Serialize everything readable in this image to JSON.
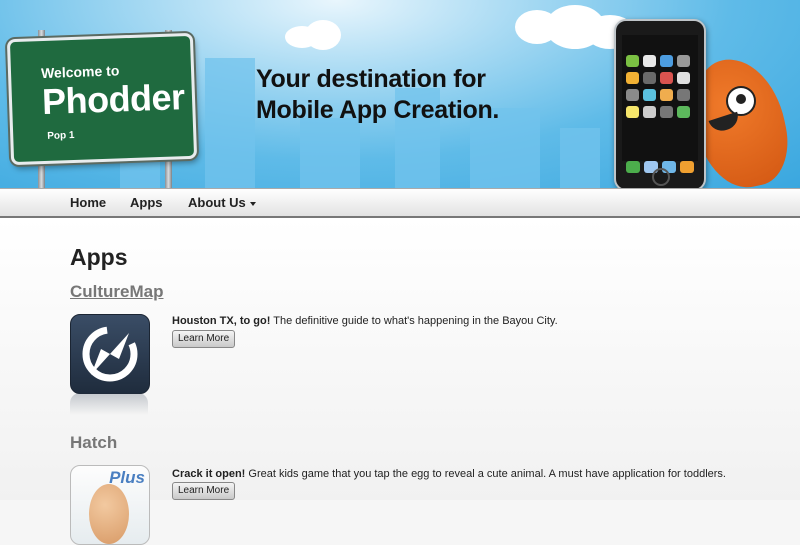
{
  "banner": {
    "sign": {
      "line1": "Welcome to",
      "line2": "Phodder",
      "pop": "Pop 1"
    },
    "tagline": {
      "line1": "Your destination for",
      "line2": "Mobile App Creation."
    }
  },
  "nav": {
    "items": [
      {
        "label": "Home"
      },
      {
        "label": "Apps"
      },
      {
        "label": "About Us",
        "icon": "caret-down-icon"
      }
    ]
  },
  "page": {
    "heading": "Apps",
    "apps": [
      {
        "title": "CultureMap",
        "desc_bold": "Houston TX, to go!",
        "desc_rest": " The definitive guide to what's happening in the Bayou City.",
        "button": "Learn More",
        "icon": "compass-icon",
        "icon_color": "#2b3b50"
      },
      {
        "title": "Hatch",
        "desc_bold": "Crack it open!",
        "desc_rest": " Great kids game that you tap the egg to reveal a cute animal. A must have application for toddlers.",
        "button": "Learn More",
        "icon": "egg-icon",
        "icon_badge": "Plus"
      }
    ]
  },
  "colors": {
    "sky": "#3aa7df",
    "sign_green": "#1f6a3f",
    "monster": "#e0661c",
    "title_gray": "#777777"
  }
}
